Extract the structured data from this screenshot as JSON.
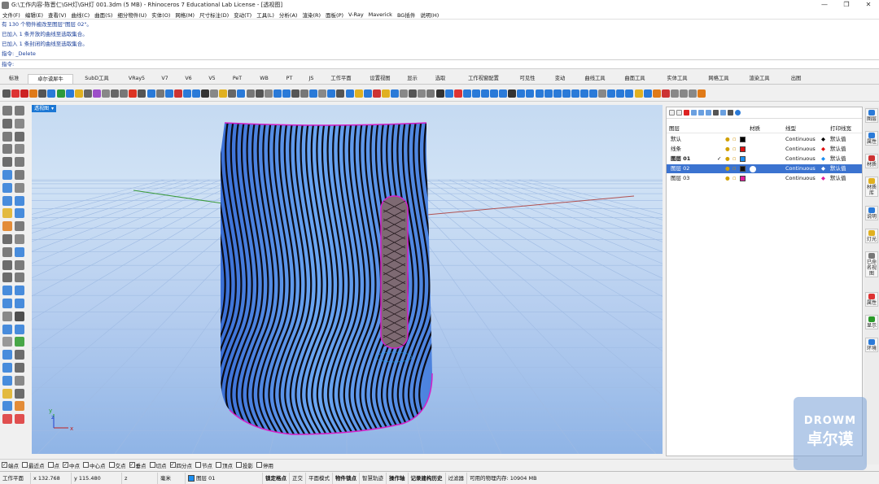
{
  "window": {
    "title": "G:\\工作内容-陈晋仁\\GH灯\\GH灯 001.3dm (5 MB) - Rhinoceros 7 Educational Lab License - [透视图]",
    "controls": [
      "—",
      "❐",
      "✕"
    ]
  },
  "menu": [
    "文件(F)",
    "编辑(E)",
    "查看(V)",
    "曲线(C)",
    "曲面(S)",
    "细分物件(U)",
    "实体(O)",
    "网格(M)",
    "尺寸标注(D)",
    "变动(T)",
    "工具(L)",
    "分析(A)",
    "渲染(R)",
    "面板(P)",
    "V-Ray",
    "Maverick",
    "BG插件",
    "说明(H)"
  ],
  "command_history": [
    "有 130 个物件被改至图层\"图层 02\"。",
    "已加入 1 条开放的曲线至选取集合。",
    "已加入 1 条封闭的曲线至选取集合。",
    "指令: _Delete"
  ],
  "command_prompt": "指令:",
  "tabs": [
    "标准",
    "卓尔谟犀牛",
    "SubD工具",
    "VRay5",
    "V7",
    "V6",
    "V5",
    "PeT",
    "WB",
    "PT",
    "JS",
    "工作平面",
    "设置视图",
    "显示",
    "选取",
    "工作视窗配置",
    "可见性",
    "变动",
    "曲线工具",
    "曲面工具",
    "实体工具",
    "网格工具",
    "渲染工具",
    "出图"
  ],
  "active_tab": 1,
  "toolbar_colors": [
    "#5a5a5a",
    "#d33",
    "#c22",
    "#e07a18",
    "#555",
    "#2a7ad8",
    "#2c9a3c",
    "#2a7ad8",
    "#e0b020",
    "#666",
    "#9c4ec8",
    "#888",
    "#666",
    "#777",
    "#d32",
    "#555",
    "#2a7ad8",
    "#777",
    "#2a7ad8",
    "#c33",
    "#2a7ad8",
    "#2a7ad8",
    "#333",
    "#888",
    "#e0b020",
    "#666",
    "#2a7ad8",
    "#777",
    "#555",
    "#888",
    "#2a7ad8",
    "#2a7ad8",
    "#555",
    "#777",
    "#2a7ad8",
    "#888",
    "#2a7ad8",
    "#555",
    "#2a7ad8",
    "#e0b020",
    "#2a7ad8",
    "#c33",
    "#e0b020",
    "#2a7ad8",
    "#888",
    "#555",
    "#888",
    "#777",
    "#333",
    "#2a7ad8",
    "#d33",
    "#2a7ad8",
    "#2a7ad8",
    "#2a7ad8",
    "#2a7ad8",
    "#2a7ad8",
    "#333",
    "#2a7ad8",
    "#2a7ad8",
    "#2a7ad8",
    "#2a7ad8",
    "#2a7ad8",
    "#2a7ad8",
    "#2a7ad8",
    "#2a7ad8",
    "#2a7ad8",
    "#888",
    "#2a7ad8",
    "#2a7ad8",
    "#2a7ad8",
    "#e0b020",
    "#2a7ad8",
    "#e07a18",
    "#c33",
    "#888",
    "#888",
    "#888",
    "#e07a18"
  ],
  "viewport": {
    "label": "透视图",
    "axes": {
      "x": "x",
      "y": "y",
      "z": "z"
    }
  },
  "layers_panel": {
    "headers": {
      "name": "图层",
      "material": "材质",
      "linetype": "线型",
      "print_color": "打印线宽"
    },
    "rows": [
      {
        "name": "默认",
        "current": false,
        "color": "#000000",
        "linetype": "Continuous",
        "print": "默认值",
        "diamond": "#000000",
        "selected": false
      },
      {
        "name": "线条",
        "current": false,
        "color": "#e01010",
        "linetype": "Continuous",
        "print": "默认值",
        "diamond": "#e01010",
        "selected": false
      },
      {
        "name": "图层 01",
        "current": true,
        "color": "#1a8ef0",
        "linetype": "Continuous",
        "print": "默认值",
        "diamond": "#1a8ef0",
        "selected": false
      },
      {
        "name": "图层 02",
        "current": false,
        "color": "#111111",
        "linetype": "Continuous",
        "print": "默认值",
        "diamond": "#000000",
        "selected": true
      },
      {
        "name": "图层 03",
        "current": false,
        "color": "#e01e9c",
        "linetype": "Continuous",
        "print": "默认值",
        "diamond": "#e01e9c",
        "selected": false
      }
    ],
    "check": "✓"
  },
  "right_tabs": [
    "图层",
    "属性",
    "材质",
    "材质库",
    "说明",
    "灯光",
    "已命名视图",
    "属性",
    "显示",
    "环境"
  ],
  "osnaps": [
    {
      "label": "端点",
      "checked": true
    },
    {
      "label": "最近点",
      "checked": false
    },
    {
      "label": "点",
      "checked": false
    },
    {
      "label": "中点",
      "checked": true
    },
    {
      "label": "中心点",
      "checked": false
    },
    {
      "label": "交点",
      "checked": false
    },
    {
      "label": "垂点",
      "checked": true
    },
    {
      "label": "切点",
      "checked": false
    },
    {
      "label": "四分点",
      "checked": true
    },
    {
      "label": "节点",
      "checked": false
    },
    {
      "label": "顶点",
      "checked": false
    },
    {
      "label": "投影",
      "checked": false
    },
    {
      "label": "停用",
      "checked": false
    }
  ],
  "status": {
    "cplane": "工作平面",
    "x": "x 132.768",
    "y": "y 115.480",
    "z": "z",
    "unit": "毫米",
    "layer": "图层 01",
    "toggles": [
      "锁定格点",
      "正交",
      "平面模式",
      "物件锁点",
      "智慧轨迹",
      "操作轴",
      "记录建构历史",
      "过滤器"
    ],
    "memory": "可用的物理内存: 10904 MB"
  },
  "watermark": {
    "brand": "DROWM",
    "cn": "卓尔谟"
  }
}
